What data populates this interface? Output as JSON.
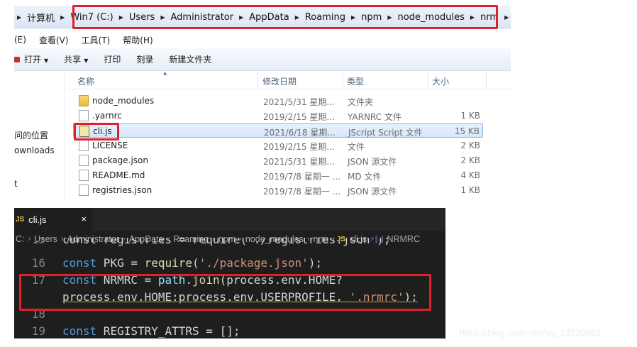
{
  "explorer": {
    "address": [
      "计算机",
      "Win7 (C:)",
      "Users",
      "Administrator",
      "AppData",
      "Roaming",
      "npm",
      "node_modules",
      "nrm"
    ],
    "menu": [
      "(E)",
      "查看(V)",
      "工具(T)",
      "帮助(H)"
    ],
    "toolbar": {
      "open": "打开",
      "share": "共享",
      "print": "打印",
      "burn": "刻录",
      "new_folder": "新建文件夹"
    },
    "nav": [
      "问的位置",
      "ownloads",
      "t"
    ],
    "columns": {
      "name": "名称",
      "date": "修改日期",
      "type": "类型",
      "size": "大小"
    },
    "files": [
      {
        "name": "node_modules",
        "date": "2021/5/31 星期...",
        "type": "文件夹",
        "size": "",
        "icon": "folder-icon"
      },
      {
        "name": ".yarnrc",
        "date": "2019/2/15 星期...",
        "type": "YARNRC 文件",
        "size": "1 KB",
        "icon": "file-icon"
      },
      {
        "name": "cli.js",
        "date": "2021/6/18 星期...",
        "type": "JScript Script 文件",
        "size": "15 KB",
        "icon": "jscript-file-icon"
      },
      {
        "name": "LICENSE",
        "date": "2019/2/15 星期...",
        "type": "文件",
        "size": "2 KB",
        "icon": "file-icon"
      },
      {
        "name": "package.json",
        "date": "2021/5/31 星期...",
        "type": "JSON 源文件",
        "size": "2 KB",
        "icon": "file-icon"
      },
      {
        "name": "README.md",
        "date": "2019/7/8 星期一 ...",
        "type": "MD 文件",
        "size": "4 KB",
        "icon": "file-icon"
      },
      {
        "name": "registries.json",
        "date": "2019/7/8 星期一 ...",
        "type": "JSON 源文件",
        "size": "1 KB",
        "icon": "file-icon"
      }
    ],
    "selected_file": "cli.js"
  },
  "editor": {
    "tab_label": "cli.js",
    "tab_badge": "JS",
    "tab_close": "×",
    "breadcrumbs": [
      "C:",
      "Users",
      "Administrator",
      "AppData",
      "Roaming",
      "npm",
      "node_modules",
      "nrm"
    ],
    "breadcrumb_file": "cli.js",
    "breadcrumb_symbol": "NRMRC",
    "lines": {
      "l15": {
        "num": "15",
        "code": "const registries = require('./registries.json');"
      },
      "l16": {
        "num": "16",
        "p1": "const",
        "p2": " PKG = ",
        "p3": "require",
        "p4": "(",
        "p5": "'./package.json'",
        "p6": ");"
      },
      "l17": {
        "num": "17",
        "p1": "const",
        "p2": " NRMRC = ",
        "p3": "path",
        "p4": ".",
        "p5": "join",
        "p6": "(process.env.HOME?"
      },
      "l17b": {
        "p1": "process.env.HOME:process.env.USERPROFILE, ",
        "p2": "'.nrmrc'",
        "p3": ");"
      },
      "l18": {
        "num": "18"
      },
      "l19": {
        "num": "19",
        "p1": "const",
        "p2": " REGISTRY_ATTRS = [];"
      }
    }
  },
  "watermark": "https://blog.csdn.net/qq_23539691",
  "colors": {
    "highlight": "#e0202a",
    "editor_bg": "#1e1e1e",
    "keyword": "#569cd6",
    "string": "#ce9178"
  }
}
